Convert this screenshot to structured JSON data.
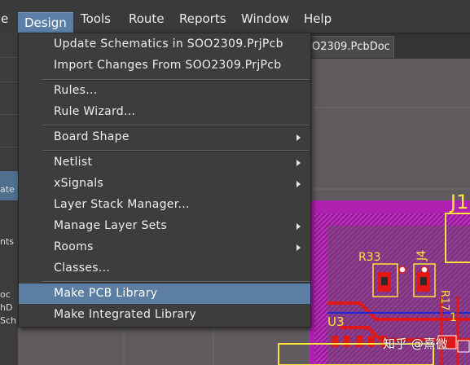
{
  "menubar": {
    "items": [
      {
        "label": "e"
      },
      {
        "label": "Design"
      },
      {
        "label": "Tools"
      },
      {
        "label": "Route"
      },
      {
        "label": "Reports"
      },
      {
        "label": "Window"
      },
      {
        "label": "Help"
      }
    ]
  },
  "document_tab": {
    "label": "O2309.PcbDoc"
  },
  "left_panel": {
    "fragments": [
      "ate",
      "nts",
      "oc",
      "hD",
      "Sch"
    ]
  },
  "design_menu": {
    "items": [
      {
        "label": "Update Schematics in SOO2309.PrjPcb",
        "submenu": false
      },
      {
        "label": "Import Changes From SOO2309.PrjPcb",
        "submenu": false
      },
      {
        "label": "Rules...",
        "submenu": false
      },
      {
        "label": "Rule Wizard...",
        "submenu": false
      },
      {
        "label": "Board Shape",
        "submenu": true
      },
      {
        "label": "Netlist",
        "submenu": true
      },
      {
        "label": "xSignals",
        "submenu": true
      },
      {
        "label": "Layer Stack Manager...",
        "submenu": false
      },
      {
        "label": "Manage Layer Sets",
        "submenu": true
      },
      {
        "label": "Rooms",
        "submenu": true
      },
      {
        "label": "Classes...",
        "submenu": false
      },
      {
        "label": "Make PCB Library",
        "submenu": false,
        "highlighted": true
      },
      {
        "label": "Make Integrated Library",
        "submenu": false
      }
    ]
  },
  "pcb_labels": {
    "j_label": "J1",
    "r33": "R33",
    "j4": "J4",
    "r17": "R17",
    "u3": "U3",
    "one": "1"
  },
  "watermark": {
    "text": "知乎 @熹微"
  },
  "colors": {
    "menu_highlight": "#5c7ea2",
    "menu_bg": "#3d3d3d",
    "board_magenta": "#b020b0",
    "copper_red": "#e01818",
    "silkscreen_yellow": "#ffe23a",
    "blue_trace": "#1a2ad8"
  }
}
